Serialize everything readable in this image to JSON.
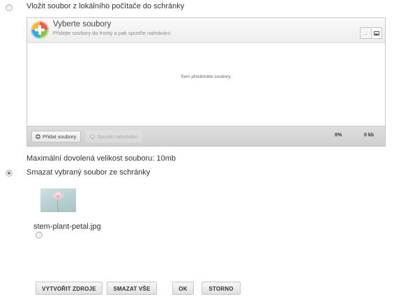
{
  "options": {
    "upload_label": "Vložit soubor z lokálního počítače do schránky",
    "delete_label": "Smazat vybraný soubor ze schránky"
  },
  "uploader": {
    "title": "Vyberte soubory",
    "subtitle": "Přidejte soubory do fronty a pak spusťte nahrávání.",
    "drop_text": "Sem přetáhněte soubory.",
    "add_button": "Přidat soubory",
    "start_button": "Spustit nahrávání",
    "percent": "0%",
    "size": "0 kb",
    "view_icons": [
      "list-view-icon",
      "thumbnail-view-icon"
    ]
  },
  "max_size_text": "Maximální dovolená velikost souboru: 10mb",
  "file": {
    "name": "stem-plant-petal.jpg"
  },
  "buttons": {
    "create": "VYTVOŘIT ZDROJE",
    "delete_all": "SMAZAT VŠE",
    "ok": "OK",
    "cancel": "STORNO"
  }
}
